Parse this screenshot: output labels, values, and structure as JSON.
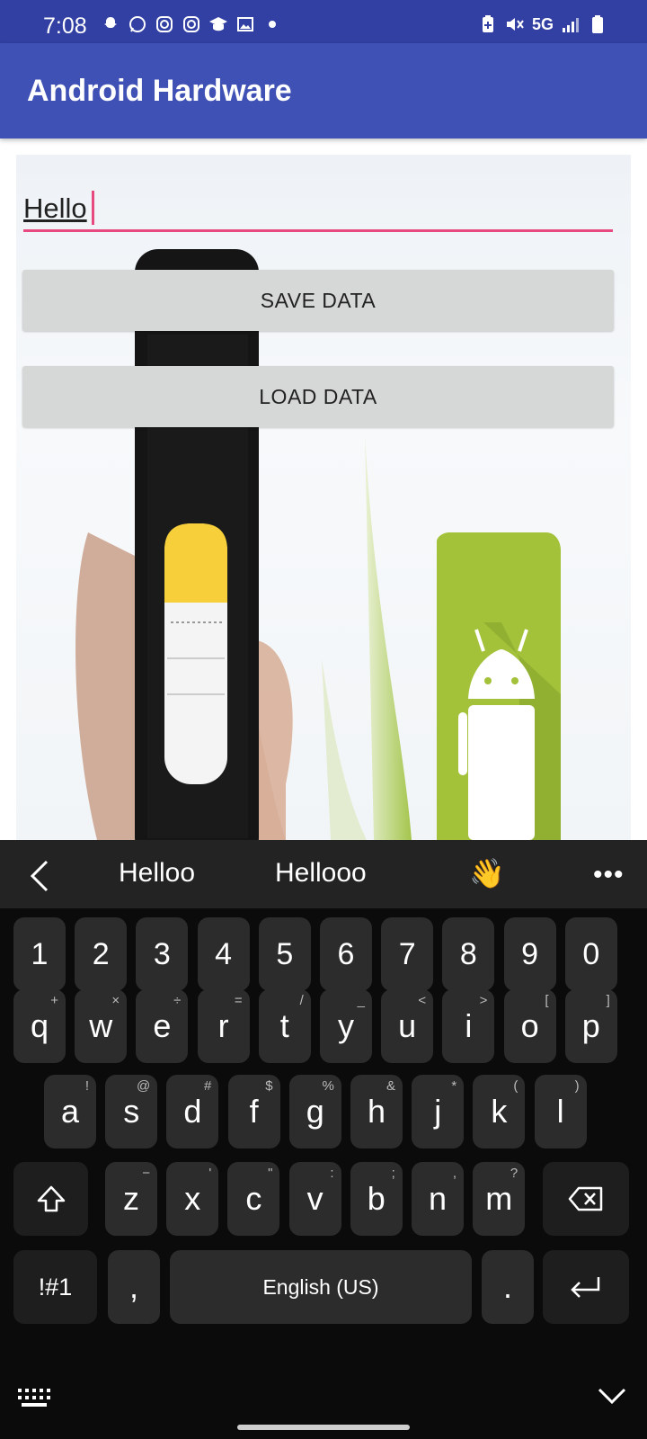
{
  "status_bar": {
    "time": "7:08",
    "network": "5G",
    "left_icons": [
      "snapchat-icon",
      "whatsapp-icon",
      "instagram-icon",
      "instagram-icon",
      "graduation-cap-icon",
      "gallery-icon",
      "dot-icon"
    ],
    "right_icons": [
      "battery-saver-icon",
      "mute-icon",
      "signal-icon",
      "battery-icon"
    ]
  },
  "app_bar": {
    "title": "Android Hardware"
  },
  "main": {
    "input": {
      "value": "Hello"
    },
    "save_button": "SAVE DATA",
    "load_button": "LOAD DATA"
  },
  "suggestions": {
    "items": [
      "Helloo",
      "Hellooo",
      "👋"
    ]
  },
  "keyboard": {
    "number_row": [
      "1",
      "2",
      "3",
      "4",
      "5",
      "6",
      "7",
      "8",
      "9",
      "0"
    ],
    "row1": [
      {
        "k": "q",
        "h": "+"
      },
      {
        "k": "w",
        "h": "×"
      },
      {
        "k": "e",
        "h": "÷"
      },
      {
        "k": "r",
        "h": "="
      },
      {
        "k": "t",
        "h": "/"
      },
      {
        "k": "y",
        "h": "_"
      },
      {
        "k": "u",
        "h": "<"
      },
      {
        "k": "i",
        "h": ">"
      },
      {
        "k": "o",
        "h": "["
      },
      {
        "k": "p",
        "h": "]"
      }
    ],
    "row2": [
      {
        "k": "a",
        "h": "!"
      },
      {
        "k": "s",
        "h": "@"
      },
      {
        "k": "d",
        "h": "#"
      },
      {
        "k": "f",
        "h": "$"
      },
      {
        "k": "g",
        "h": "%"
      },
      {
        "k": "h",
        "h": "&"
      },
      {
        "k": "j",
        "h": "*"
      },
      {
        "k": "k",
        "h": "("
      },
      {
        "k": "l",
        "h": ")"
      }
    ],
    "row3": [
      {
        "k": "z",
        "h": "−"
      },
      {
        "k": "x",
        "h": "'"
      },
      {
        "k": "c",
        "h": "\""
      },
      {
        "k": "v",
        "h": ":"
      },
      {
        "k": "b",
        "h": ";"
      },
      {
        "k": "n",
        "h": ","
      },
      {
        "k": "m",
        "h": "?"
      }
    ],
    "symbols_key": "!#1",
    "comma_key": ",",
    "space_key": "English (US)",
    "period_key": ".",
    "colors": {
      "background": "#0b0b0b",
      "key": "#2c2c2c",
      "accent": "#e64a7f",
      "app_bar": "#3f51b5"
    }
  }
}
